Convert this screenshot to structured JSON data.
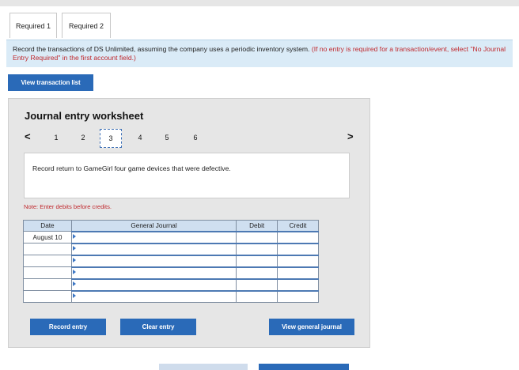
{
  "tabs": [
    {
      "label": "Required 1"
    },
    {
      "label": "Required 2"
    }
  ],
  "instruction": {
    "main": "Record the transactions of DS Unlimited, assuming the company uses a periodic inventory system.",
    "note": "(If no entry is required for a transaction/event, select \"No Journal Entry Required\" in the first account field.)"
  },
  "view_transaction_list_label": "View transaction list",
  "worksheet": {
    "title": "Journal entry worksheet",
    "prev_arrow": "<",
    "next_arrow": ">",
    "steps": [
      "1",
      "2",
      "3",
      "4",
      "5",
      "6"
    ],
    "active_step": "3",
    "description": "Record return to GameGirl four game devices that were defective.",
    "note": "Note: Enter debits before credits.",
    "columns": {
      "date": "Date",
      "general_journal": "General Journal",
      "debit": "Debit",
      "credit": "Credit"
    },
    "rows": [
      {
        "date": "August 10",
        "account": "",
        "debit": "",
        "credit": ""
      },
      {
        "date": "",
        "account": "",
        "debit": "",
        "credit": ""
      },
      {
        "date": "",
        "account": "",
        "debit": "",
        "credit": ""
      },
      {
        "date": "",
        "account": "",
        "debit": "",
        "credit": ""
      },
      {
        "date": "",
        "account": "",
        "debit": "",
        "credit": ""
      },
      {
        "date": "",
        "account": "",
        "debit": "",
        "credit": ""
      }
    ],
    "record_entry_label": "Record entry",
    "clear_entry_label": "Clear entry",
    "view_general_journal_label": "View general journal"
  },
  "colors": {
    "accent": "#2a6ab8",
    "instruction_bg": "#daebf7",
    "note_red": "#c0282d"
  }
}
